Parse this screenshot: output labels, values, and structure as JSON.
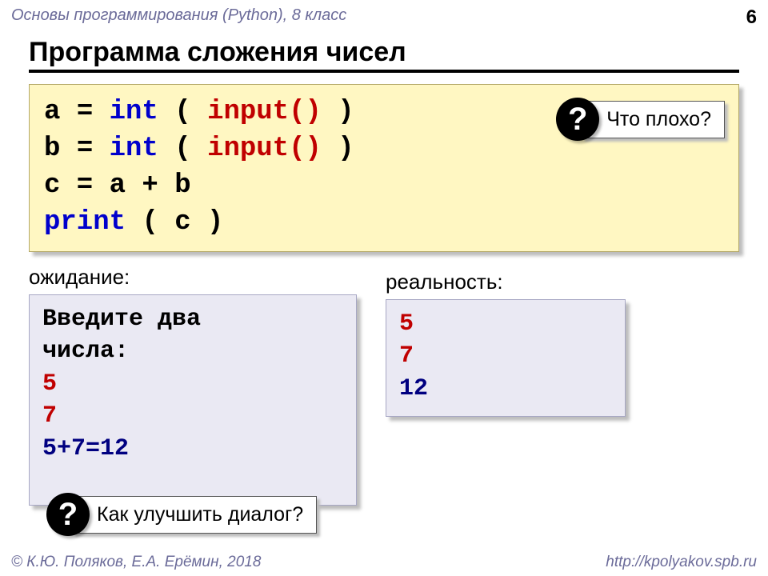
{
  "header": {
    "course": "Основы программирования (Python), 8 класс",
    "page": "6"
  },
  "title": "Программа сложения чисел",
  "code": {
    "l1_var": "a",
    "l1_eq": "=",
    "l1_int": "int",
    "l1_open": "(",
    "l1_input": "input()",
    "l1_close": ")",
    "l2_var": "b",
    "l3": "c = a + b",
    "l4_print": "print",
    "l4_rest": "( c )"
  },
  "labels": {
    "expect": "ожидание:",
    "reality": "реальность:"
  },
  "expect_box": {
    "prompt1": "Введите два",
    "prompt2": "числа:",
    "in1": "5",
    "in2": "7",
    "sum": "5+7=12"
  },
  "reality_box": {
    "in1": "5",
    "in2": "7",
    "out": "12"
  },
  "bubbles": {
    "q": "?",
    "top": "Что плохо?",
    "bottom": "Как улучшить диалог?"
  },
  "footer": {
    "left": "© К.Ю. Поляков, Е.А. Ерёмин, 2018",
    "right": "http://kpolyakov.spb.ru"
  }
}
